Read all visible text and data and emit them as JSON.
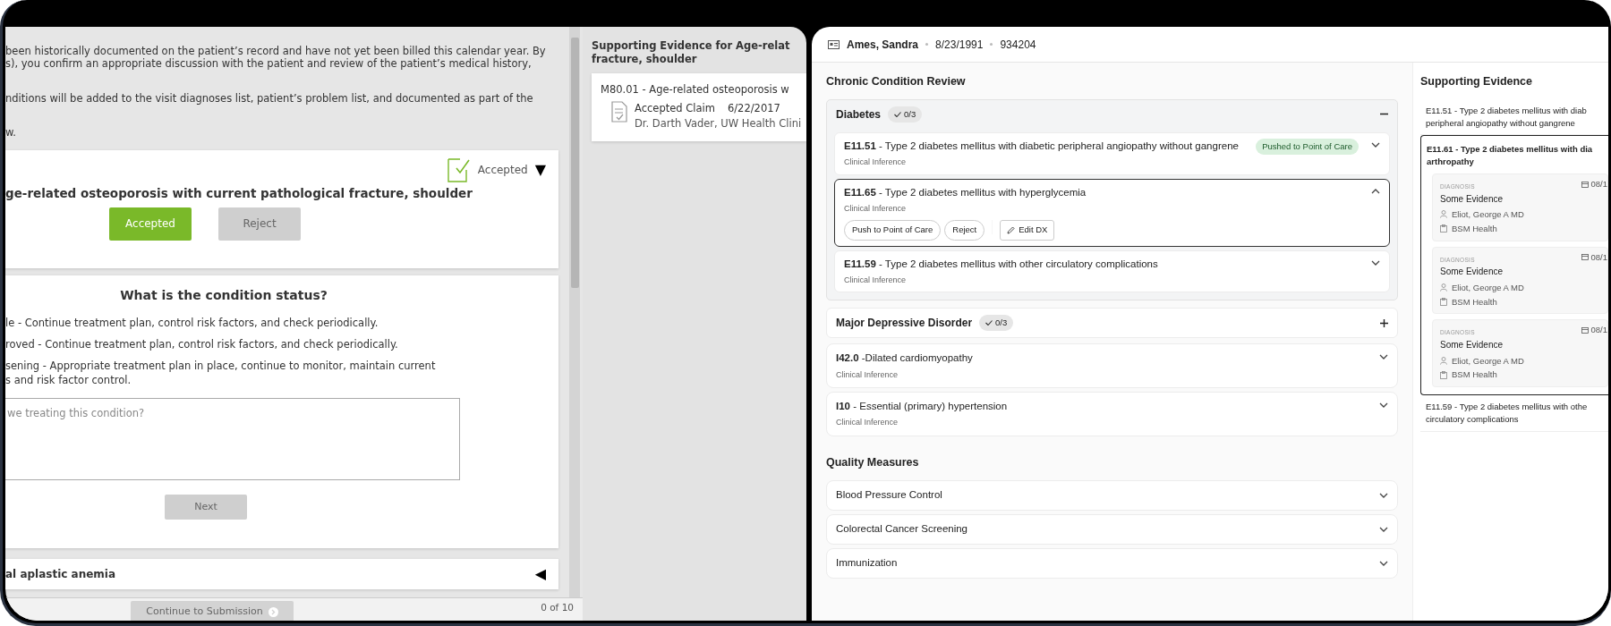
{
  "intro": [
    {
      "lines": [
        "been historically documented on the patient’s record and have not yet been billed this calendar year. By",
        "s), you confirm an appropriate discussion with the patient and review of the patient’s medical history,"
      ]
    },
    {
      "lines": [
        "nditions will be added to the visit diagnoses list, patient’s problem list, and documented as part of the"
      ]
    },
    {
      "lines": [
        "w."
      ]
    }
  ],
  "condition_card": {
    "status_label": "Accepted",
    "status_toggle": "▼",
    "title": "ge-related osteoporosis with current pathological fracture, shoulder",
    "buttons": [
      {
        "label": "Accepted",
        "selected": true
      },
      {
        "label": "Reject",
        "selected": false
      }
    ]
  },
  "status_question": {
    "title": "What is the condition status?",
    "options": [
      {
        "lines": [
          "le - Continue treatment plan, control risk factors, and check periodically."
        ]
      },
      {
        "lines": [
          "roved - Continue treatment plan, control risk factors, and check periodically."
        ]
      },
      {
        "lines": [
          "sening - Appropriate treatment plan in place, continue to monitor, maintain current",
          "s and risk factor control."
        ]
      }
    ],
    "textarea": {
      "placeholder": "we treating this condition?"
    },
    "next_button": {
      "label": "Next",
      "disabled": true
    }
  },
  "collapsed_condition": {
    "title": "al aplastic anemia",
    "toggle": "◀"
  },
  "footer": {
    "continue_button": {
      "label": "Continue to Submission",
      "disabled": true
    },
    "progress": "0 of 10"
  },
  "middle": {
    "title_lines": [
      "Supporting Evidence for Age-relat",
      "fracture, shoulder"
    ],
    "evidence": {
      "title": "M80.01 - Age-related osteoporosis w",
      "kind_label": "Accepted Claim",
      "date": "6/22/2017",
      "source": "Dr. Darth Vader, UW Health Clini"
    }
  },
  "patient": {
    "name": "Ames, Sandra",
    "dob": "8/23/1991",
    "mrn": "934204"
  },
  "chronic": {
    "title": "Chronic Condition Review",
    "groups": [
      {
        "name": "Diabetes",
        "badge": "0/3",
        "expanded": true,
        "items": [
          {
            "code": "E11.51",
            "description": "- Type 2 diabetes mellitus with diabetic peripheral angiopathy without gangrene",
            "source": "Clinical Inference",
            "tag": "Pushed to Point of Care",
            "selected": false,
            "expanded": false
          },
          {
            "code": "E11.65",
            "description": "- Type 2 diabetes mellitus with hyperglycemia",
            "source": "Clinical Inference",
            "selected": true,
            "expanded": true,
            "actions": [
              {
                "label": "Push to Point of Care",
                "kind": "pill"
              },
              {
                "label": "Reject",
                "kind": "pill"
              },
              {
                "label": "Edit DX",
                "kind": "edit"
              }
            ]
          },
          {
            "code": "E11.59",
            "description": "- Type 2 diabetes mellitus with other circulatory complications",
            "source": "Clinical Inference",
            "selected": false,
            "expanded": false
          }
        ]
      },
      {
        "name": "Major Depressive Disorder",
        "badge": "0/3",
        "expanded": false
      }
    ],
    "conditions": [
      {
        "code": "I42.0",
        "description": "-Dilated cardiomyopathy",
        "source": "Clinical Inference",
        "expanded": false
      },
      {
        "code": "I10",
        "description": "- Essential (primary) hypertension",
        "source": "Clinical Inference",
        "expanded": false
      }
    ]
  },
  "quality": {
    "title": "Quality Measures",
    "items": [
      {
        "label": "Blood Pressure Control",
        "expanded": false
      },
      {
        "label": "Colorectal Cancer Screening",
        "expanded": false
      },
      {
        "label": "Immunization",
        "expanded": false
      }
    ]
  },
  "sidebar": {
    "title": "Supporting Evidence",
    "items": [
      {
        "lines": [
          "E11.51 - Type 2 diabetes mellitus with diab",
          "peripheral angiopathy without gangrene"
        ],
        "selected": false
      },
      {
        "lines": [
          "E11.61 - Type 2 diabetes mellitus with dia",
          "arthropathy"
        ],
        "selected": true,
        "evidence": [
          {
            "type": "DIAGNOSIS",
            "date": "08/1",
            "title": "Some Evidence",
            "provider": "Eliot, George A MD",
            "facility": "BSM Health"
          },
          {
            "type": "DIAGNOSIS",
            "date": "08/1",
            "title": "Some Evidence",
            "provider": "Eliot, George A MD",
            "facility": "BSM Health"
          },
          {
            "type": "DIAGNOSIS",
            "date": "08/1",
            "title": "Some Evidence",
            "provider": "Eliot, George A MD",
            "facility": "BSM Health"
          }
        ]
      },
      {
        "lines": [
          "E11.59 - Type 2 diabetes mellitus with othe",
          "circulatory complications"
        ],
        "selected": false
      }
    ]
  }
}
